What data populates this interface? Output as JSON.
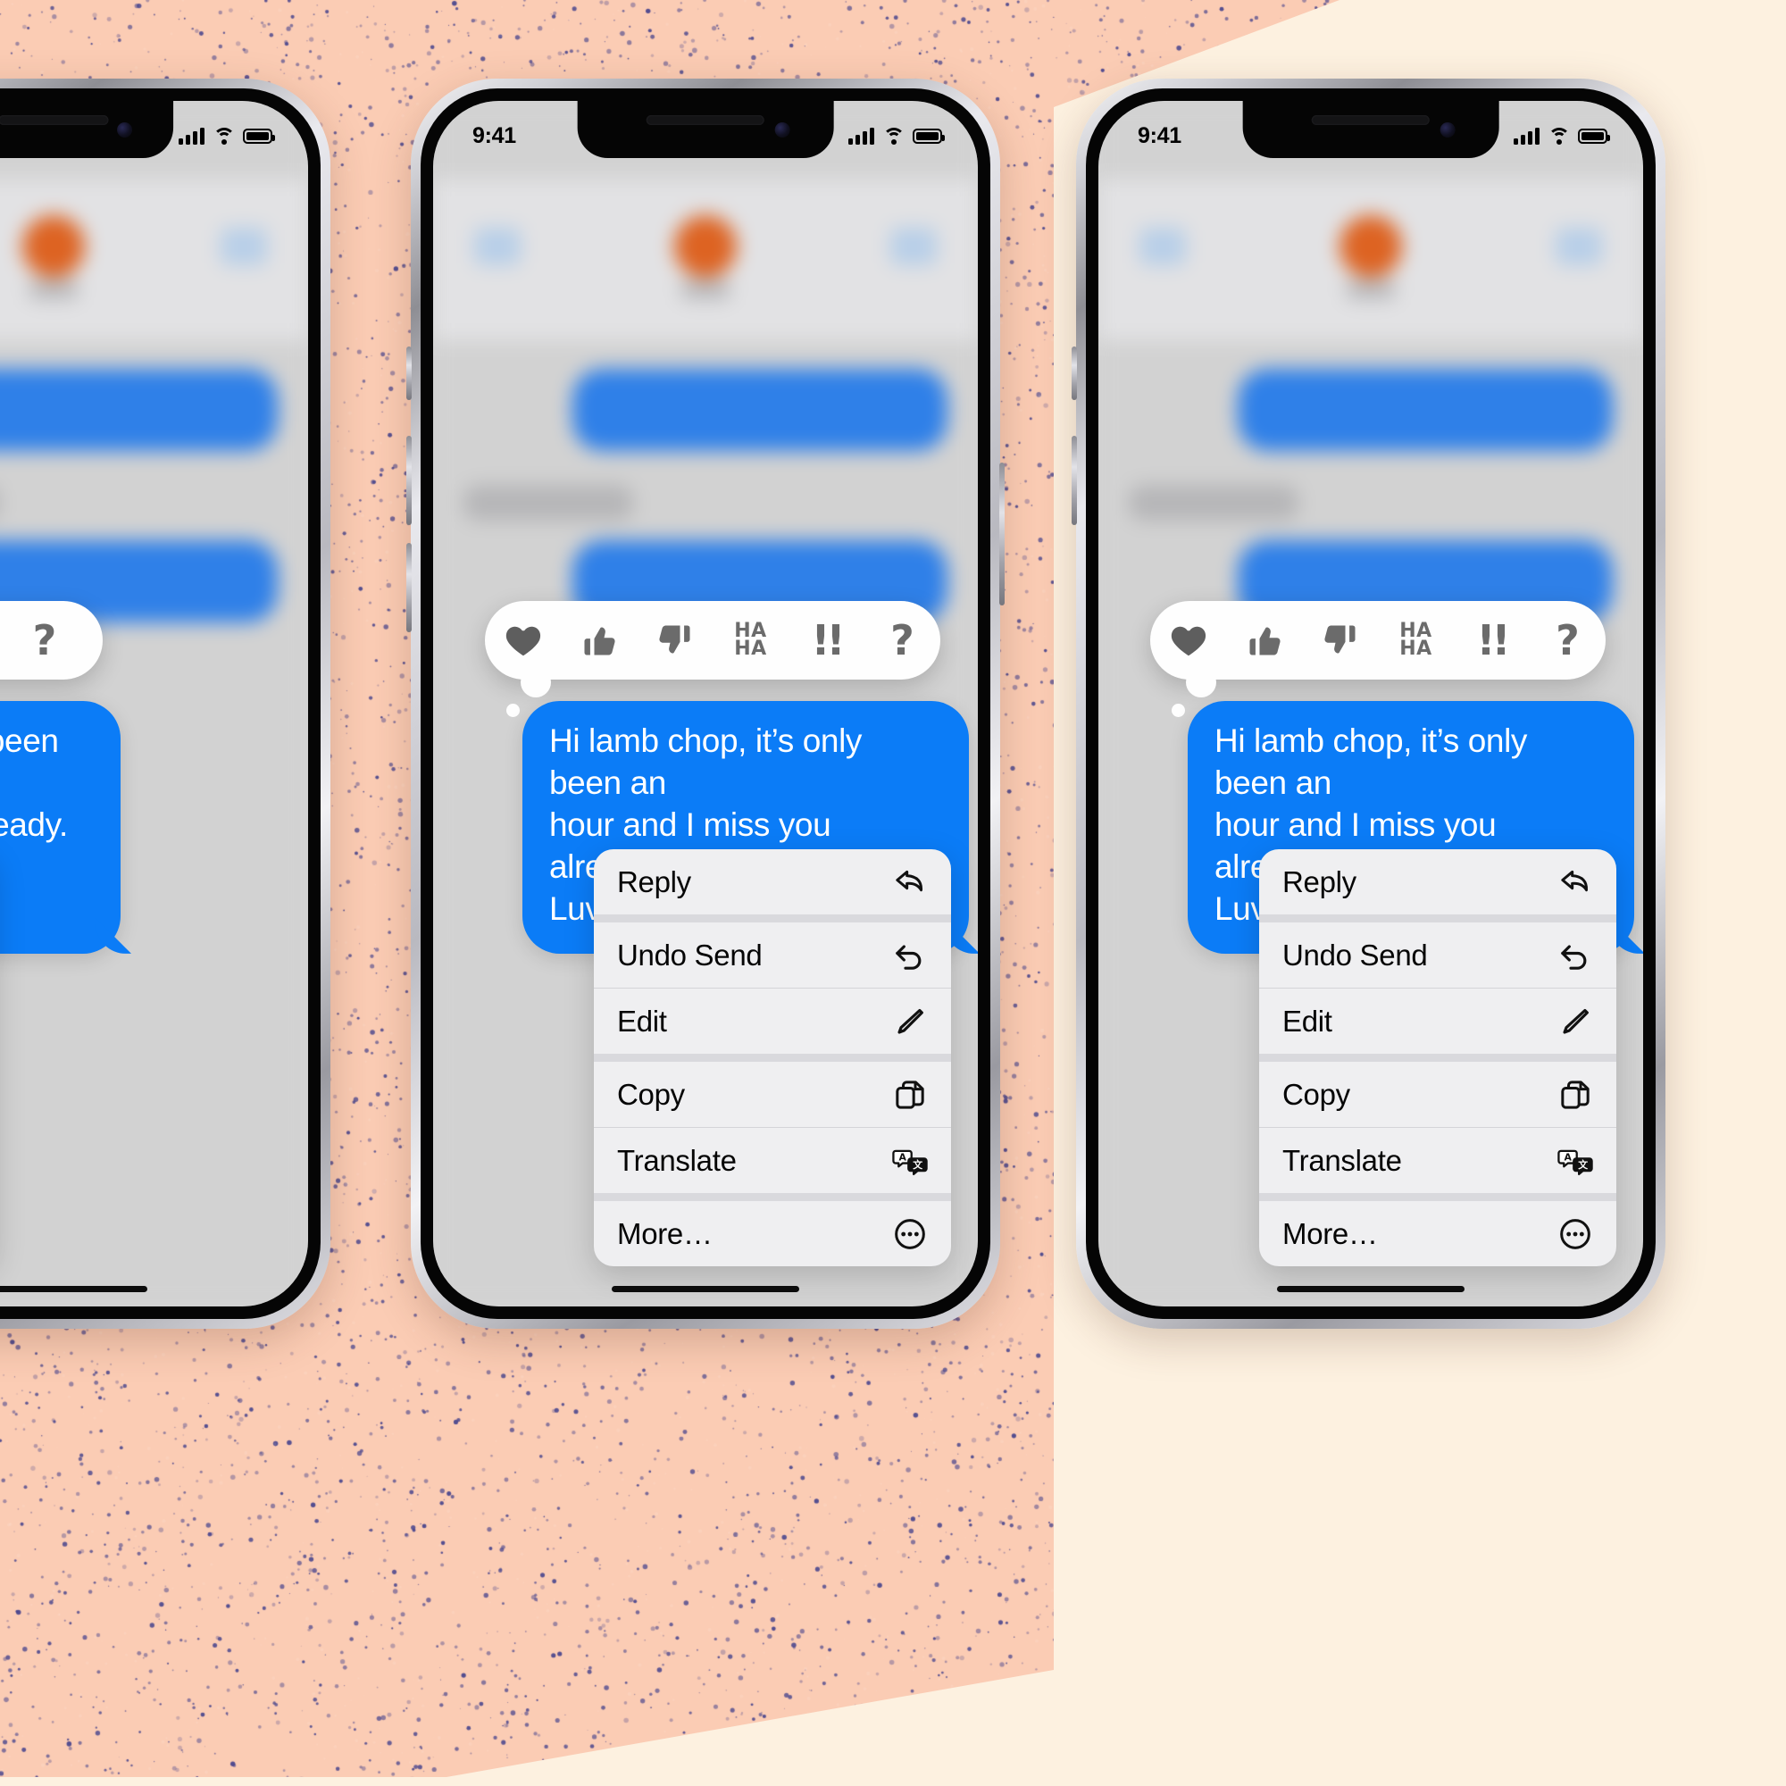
{
  "background": {
    "pink": "#fbccb4",
    "cream": "#fdf1e0",
    "speckle_color": "#2b2f87"
  },
  "phones": [
    {
      "id": "left",
      "label": "iphone-left"
    },
    {
      "id": "center",
      "label": "iphone-center"
    },
    {
      "id": "right",
      "label": "iphone-right"
    }
  ],
  "status_bar": {
    "time": "9:41",
    "cellular_icon": "signal-bars-icon",
    "wifi_icon": "wifi-icon",
    "battery_icon": "battery-icon"
  },
  "conversation": {
    "app": "Messages",
    "blurred": true,
    "avatar_color": "#dd6322",
    "bubble_blue": "#2f80e8",
    "bubble_gray": "#b6b6b8"
  },
  "tapback": {
    "items": [
      {
        "name": "heart-icon",
        "label": "Heart"
      },
      {
        "name": "thumbs-up-icon",
        "label": "Thumbs Up"
      },
      {
        "name": "thumbs-down-icon",
        "label": "Thumbs Down"
      },
      {
        "name": "haha-icon",
        "label_line1": "HA",
        "label_line2": "HA"
      },
      {
        "name": "exclamation-icon",
        "label": "!!"
      },
      {
        "name": "question-icon",
        "label": "?"
      }
    ]
  },
  "message": {
    "text": "Hi lamb chop, it’s only been an hour and I miss you already. 😕 Luv you. 😘😘",
    "line1": "Hi lamb chop, it’s only been an",
    "line2": "hour and I miss you already. 😕",
    "line3": "Luv you. 😘😘",
    "color": "#0b7cf7",
    "sender": "me"
  },
  "context_menu": {
    "items": [
      {
        "label": "Reply",
        "icon": "reply-arrow-icon"
      },
      {
        "label": "Undo Send",
        "icon": "undo-arrow-icon"
      },
      {
        "label": "Edit",
        "icon": "pencil-icon"
      },
      {
        "label": "Copy",
        "icon": "copy-icon"
      },
      {
        "label": "Translate",
        "icon": "translate-icon"
      },
      {
        "label": "More…",
        "icon": "ellipsis-circle-icon"
      }
    ]
  }
}
